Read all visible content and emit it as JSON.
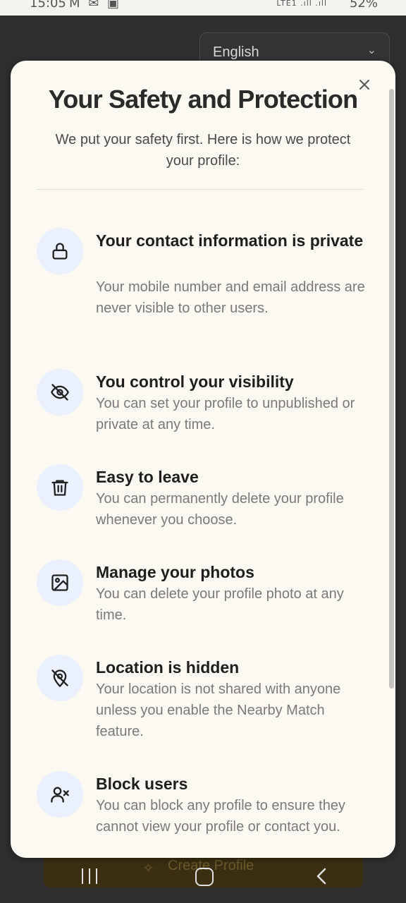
{
  "status_bar": {
    "time": "15:05",
    "notification_icons": "M ✉ ▣",
    "network": "LTE1 .ıll .ıll",
    "battery": "52%"
  },
  "background": {
    "language_select": {
      "value": "English"
    },
    "create_profile_label": "Create Profile"
  },
  "modal": {
    "title": "Your Safety and Protection",
    "subtitle": "We put your safety first. Here is how we protect your profile:",
    "features": [
      {
        "icon": "lock-icon",
        "title": "Your contact information is private",
        "description": "Your mobile number and email address are never visible to other users."
      },
      {
        "icon": "eye-off-icon",
        "title": "You control your visibility",
        "description": "You can set your profile to unpublished or private at any time."
      },
      {
        "icon": "trash-icon",
        "title": "Easy to leave",
        "description": "You can permanently delete your profile whenever you choose."
      },
      {
        "icon": "image-icon",
        "title": "Manage your photos",
        "description": "You can delete your profile photo at any time."
      },
      {
        "icon": "location-off-icon",
        "title": "Location is hidden",
        "description": "Your location is not shared with anyone unless you enable the Nearby Match feature."
      },
      {
        "icon": "user-block-icon",
        "title": "Block users",
        "description": "You can block any profile to ensure they cannot view your profile or contact you."
      }
    ]
  },
  "colors": {
    "modal_background": "#fcf8f2",
    "icon_circle": "#eaf1fc",
    "title_text": "#2a2a2a",
    "description_text": "#7a7a7a"
  }
}
